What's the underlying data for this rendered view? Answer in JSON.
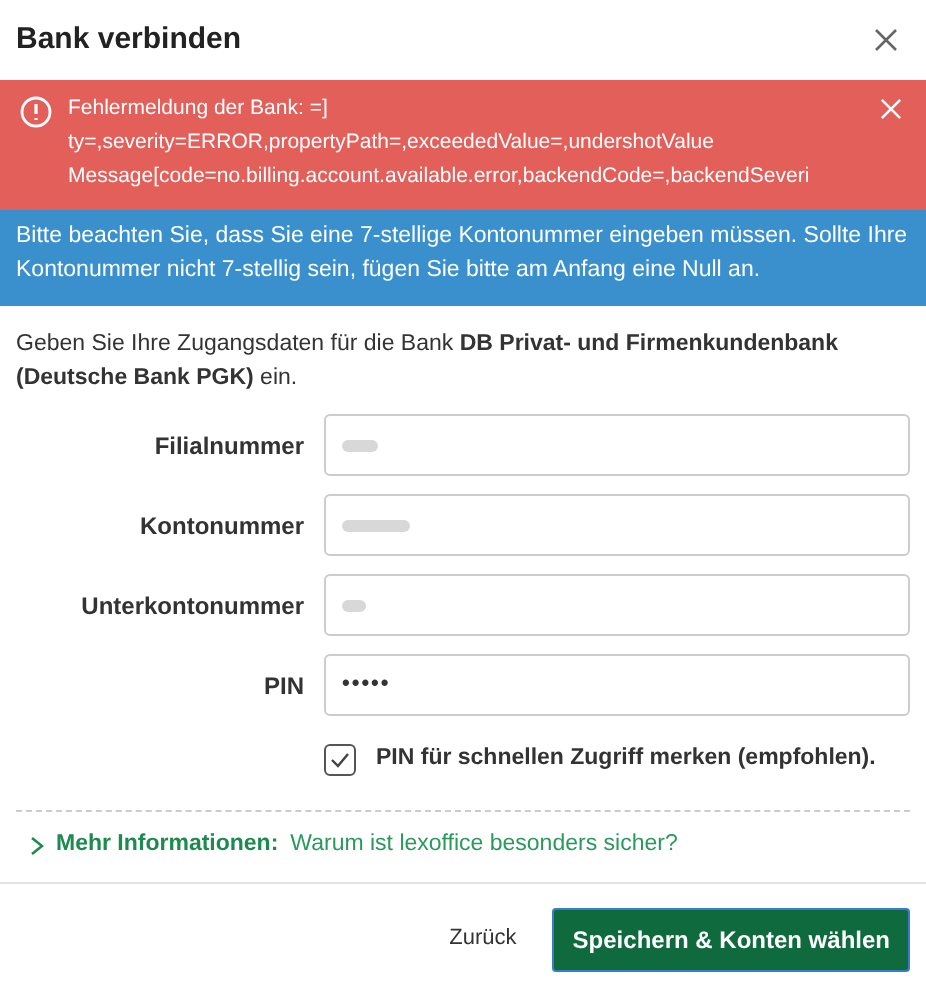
{
  "dialog": {
    "title": "Bank verbinden"
  },
  "error_banner": {
    "lines": [
      "Fehlermeldung der Bank: =]",
      "ty=,severity=ERROR,propertyPath=,exceededValue=,undershotValue",
      "Message[code=no.billing.account.available.error,backendCode=,backendSeveri"
    ]
  },
  "info_banner": {
    "text": "Bitte beachten Sie, dass Sie eine 7-stellige Kontonummer eingeben müssen. Sollte Ihre Kontonummer nicht 7-stellig sein, fügen Sie bitte am Anfang eine Null an."
  },
  "intro": "Geben Sie Ihre Zugangsdaten für die Bank **DB Privat- und Firmenkundenbank (Deutsche Bank PGK)** ein.",
  "fields": [
    {
      "label": "Filialnummer",
      "kind": "redacted"
    },
    {
      "label": "Kontonummer",
      "kind": "redacted"
    },
    {
      "label": "Unterkontonummer",
      "kind": "redacted"
    },
    {
      "label": "PIN",
      "kind": "password",
      "value": "•••••"
    }
  ],
  "remember_pin": {
    "label": "PIN für schnellen Zugriff merken (empfohlen).",
    "checked": true
  },
  "more_info": {
    "label": "Mehr Informationen:",
    "link": "Warum ist lexoffice besonders sicher?",
    "expanded": false
  },
  "buttons": {
    "back": "Zurück",
    "submit": "Speichern & Konten wählen"
  }
}
